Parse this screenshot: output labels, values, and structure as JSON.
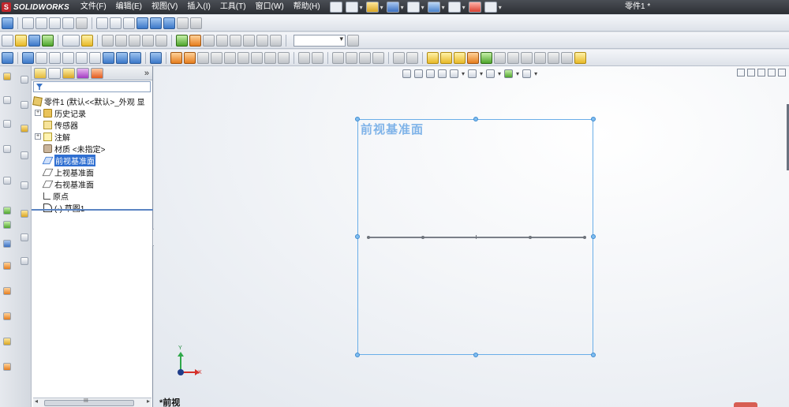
{
  "app": {
    "logo_text": "SOLIDWORKS",
    "logo_glyph": "S",
    "document_title": "零件1 *"
  },
  "menu": {
    "items": [
      "文件(F)",
      "编辑(E)",
      "视图(V)",
      "插入(I)",
      "工具(T)",
      "窗口(W)",
      "帮助(H)"
    ]
  },
  "feature_tree": {
    "more": "»",
    "root": "零件1 (默认<<默认>_外观 显",
    "nodes": [
      {
        "label": "历史记录",
        "icon": "history-folder-icon",
        "expand": "+"
      },
      {
        "label": "传感器",
        "icon": "sensor-icon",
        "expand": ""
      },
      {
        "label": "注解",
        "icon": "annotation-icon",
        "expand": "+"
      },
      {
        "label": "材质 <未指定>",
        "icon": "material-icon",
        "expand": ""
      },
      {
        "label": "前视基准面",
        "icon": "plane-icon",
        "expand": "",
        "selected": true
      },
      {
        "label": "上视基准面",
        "icon": "plane-icon",
        "expand": ""
      },
      {
        "label": "右视基准面",
        "icon": "plane-icon",
        "expand": ""
      },
      {
        "label": "原点",
        "icon": "origin-icon",
        "expand": ""
      },
      {
        "label": "(-) 草图1",
        "icon": "sketch-icon",
        "expand": ""
      }
    ],
    "scroll_grip": "III"
  },
  "graphics": {
    "plane_label": "前视基准面",
    "view_name": "*前视",
    "triad": {
      "x": "X",
      "y": "Y"
    },
    "colors": {
      "plane_border": "#6aaee8",
      "plane_label": "#7fb3e8",
      "sketch": "#7a7f88",
      "selection": "#2f6fd1"
    }
  }
}
